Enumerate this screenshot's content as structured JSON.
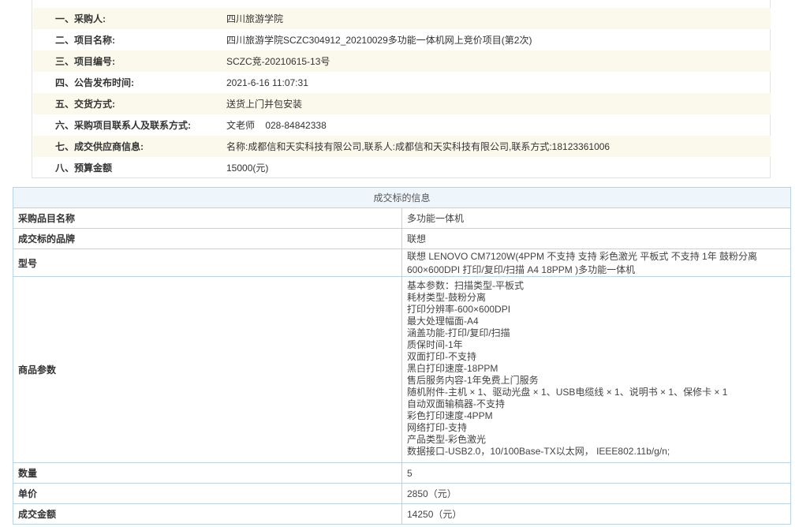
{
  "info": [
    {
      "label": "一、采购人:",
      "value": "四川旅游学院"
    },
    {
      "label": "二、项目名称:",
      "value": "四川旅游学院SCZC304912_20210029多功能一体机网上竞价项目(第2次)"
    },
    {
      "label": "三、项目编号:",
      "value": "SCZC竞-20210615-13号"
    },
    {
      "label": "四、公告发布时间:",
      "value": "2021-6-16 11:07:31"
    },
    {
      "label": "五、交货方式:",
      "value": "送货上门并包安装"
    },
    {
      "label": "六、采购项目联系人及联系方式:",
      "value": "文老师    028-84842338"
    },
    {
      "label": "七、成交供应商信息:",
      "value": "名称:成都信和天实科技有限公司,联系人:成都信和天实科技有限公司,联系方式:18123361006"
    },
    {
      "label": "八、预算金额",
      "value": "15000(元)"
    }
  ],
  "detail": {
    "header": "成交标的信息",
    "rows": [
      {
        "label": "采购品目名称",
        "value": "多功能一体机"
      },
      {
        "label": "成交标的品牌",
        "value": "联想"
      },
      {
        "label": "型号",
        "value": "联想 LENOVO CM7120W(4PPM 不支持 支持 彩色激光 平板式 不支持 1年 鼓粉分离 600×600DPI 打印/复印/扫描 A4 18PPM )多功能一体机"
      }
    ],
    "params_label": "商品参数",
    "params": [
      "基本参数：扫描类型-平板式",
      "耗材类型-鼓粉分离",
      "打印分辨率-600×600DPI",
      "最大处理幅面-A4",
      "涵盖功能-打印/复印/扫描",
      "质保时间-1年",
      "双面打印-不支持",
      "黑白打印速度-18PPM",
      "售后服务内容-1年免费上门服务",
      "随机附件-主机 × 1、驱动光盘 × 1、USB电缆线 × 1、说明书 × 1、保修卡 × 1",
      "自动双面输稿器-不支持",
      "彩色打印速度-4PPM",
      "网络打印-支持",
      "产品类型-彩色激光",
      "数据接口-USB2.0，10/100Base-TX以太网， IEEE802.11b/g/n;"
    ],
    "rows_after": [
      {
        "label": "数量",
        "value": "5"
      },
      {
        "label": "单价",
        "value": "2850（元）"
      },
      {
        "label": "成交金额",
        "value": "14250（元）"
      }
    ]
  }
}
